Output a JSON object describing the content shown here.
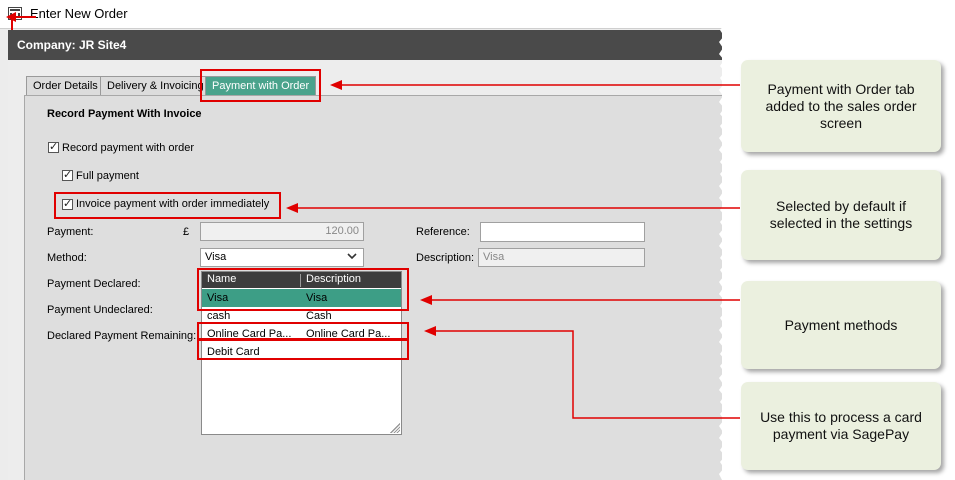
{
  "window": {
    "title": "Enter New Order"
  },
  "company": {
    "label": "Company: JR Site4"
  },
  "tabs": [
    {
      "label": "Order Details"
    },
    {
      "label": "Delivery & Invoicing"
    },
    {
      "label": "Payment with Order"
    }
  ],
  "form": {
    "section_title": "Record Payment With Invoice",
    "record_payment": {
      "label": "Record payment with order",
      "checked": true
    },
    "full_payment": {
      "label": "Full payment",
      "checked": true
    },
    "invoice_immediately": {
      "label": "Invoice payment with order immediately",
      "checked": true
    },
    "payment_label": "Payment:",
    "currency_symbol": "£",
    "payment_value": "120.00",
    "method_label": "Method:",
    "method_value": "Visa",
    "payment_declared_label": "Payment Declared:",
    "payment_undeclared_label": "Payment Undeclared:",
    "declared_remaining_label": "Declared Payment Remaining:",
    "reference_label": "Reference:",
    "reference_value": "",
    "description_label": "Description:",
    "description_value": "Visa"
  },
  "dropdown": {
    "headers": {
      "name": "Name",
      "description": "Description"
    },
    "rows": [
      {
        "name": "Visa",
        "description": "Visa",
        "selected": true
      },
      {
        "name": "cash",
        "description": "Cash",
        "selected": false
      },
      {
        "name": "Online Card Pa...",
        "description": "Online Card Pa...",
        "selected": false
      },
      {
        "name": "Debit Card",
        "description": "",
        "selected": false
      }
    ]
  },
  "callouts": [
    {
      "text": "Payment with Order tab added to the sales order screen"
    },
    {
      "text": "Selected by default if selected in the settings"
    },
    {
      "text": "Payment methods"
    },
    {
      "text": "Use this to process a card payment via SagePay"
    }
  ],
  "colors": {
    "accent": "#3d9e86",
    "highlight": "#e00000",
    "callout_bg": "#ebf0df",
    "company_bar": "#4a4a4a"
  }
}
